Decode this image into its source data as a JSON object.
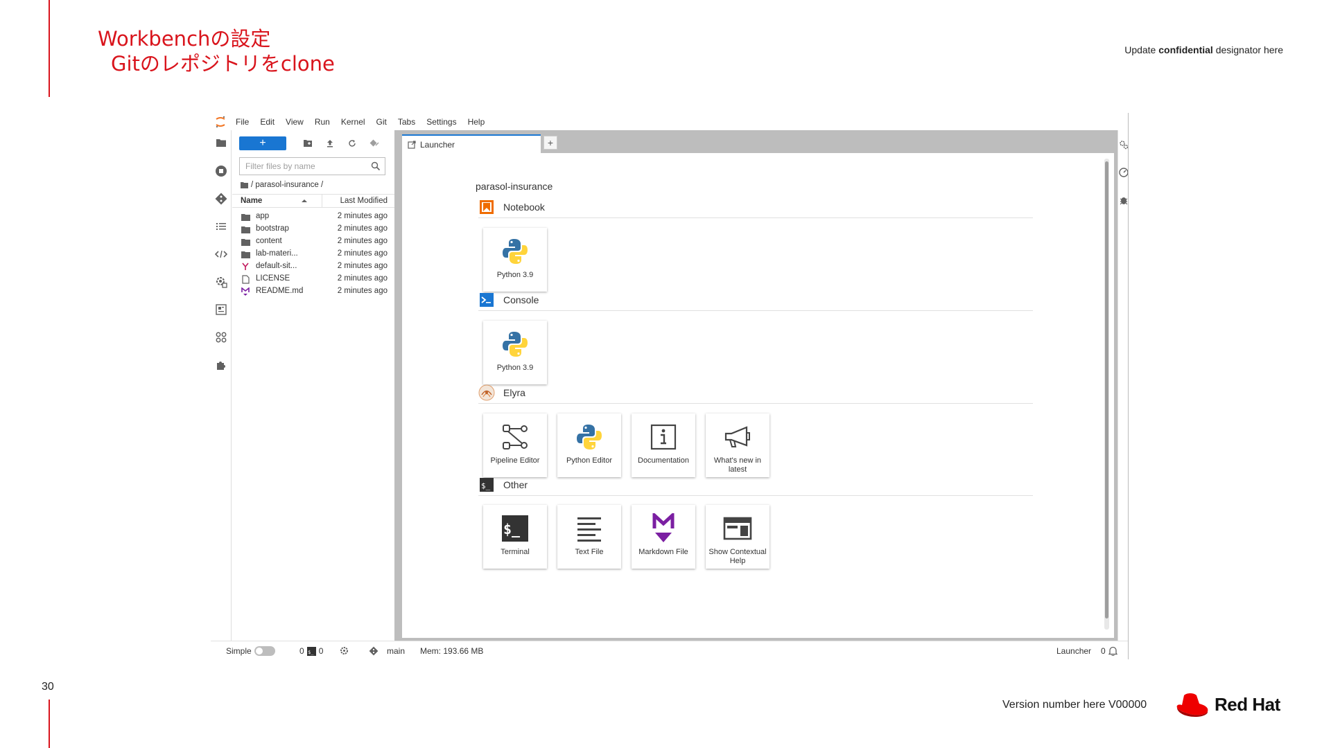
{
  "slide": {
    "title_line1": "Workbenchの設定",
    "title_line2": "Gitのレポジトリをclone",
    "confidential_prefix": "Update ",
    "confidential_bold": "confidential",
    "confidential_suffix": " designator here",
    "page_number": "30",
    "version": "Version number here V00000",
    "brand": "Red Hat",
    "accent": "#d9141c"
  },
  "menubar": {
    "items": [
      "File",
      "Edit",
      "View",
      "Run",
      "Kernel",
      "Git",
      "Tabs",
      "Settings",
      "Help"
    ]
  },
  "filebrowser": {
    "new_label": "+",
    "filter_placeholder": "Filter files by name",
    "breadcrumb": "/ parasol-insurance /",
    "col_name": "Name",
    "col_modified": "Last Modified",
    "files": [
      {
        "name": "app",
        "type": "folder",
        "modified": "2 minutes ago"
      },
      {
        "name": "bootstrap",
        "type": "folder",
        "modified": "2 minutes ago"
      },
      {
        "name": "content",
        "type": "folder",
        "modified": "2 minutes ago"
      },
      {
        "name": "lab-materi...",
        "type": "folder",
        "modified": "2 minutes ago"
      },
      {
        "name": "default-sit...",
        "type": "yaml",
        "modified": "2 minutes ago"
      },
      {
        "name": "LICENSE",
        "type": "file",
        "modified": "2 minutes ago"
      },
      {
        "name": "README.md",
        "type": "markdown",
        "modified": "2 minutes ago"
      }
    ]
  },
  "tab": {
    "label": "Launcher",
    "add_label": "+"
  },
  "launcher": {
    "cwd": "parasol-insurance",
    "sections": {
      "notebook": {
        "title": "Notebook",
        "cards": [
          {
            "label": "Python 3.9"
          }
        ]
      },
      "console": {
        "title": "Console",
        "cards": [
          {
            "label": "Python 3.9"
          }
        ]
      },
      "elyra": {
        "title": "Elyra",
        "cards": [
          {
            "label": "Pipeline Editor"
          },
          {
            "label": "Python Editor"
          },
          {
            "label": "Documentation"
          },
          {
            "label": "What's new in latest"
          }
        ]
      },
      "other": {
        "title": "Other",
        "cards": [
          {
            "label": "Terminal"
          },
          {
            "label": "Text File"
          },
          {
            "label": "Markdown File"
          },
          {
            "label": "Show Contextual Help"
          }
        ]
      }
    }
  },
  "statusbar": {
    "simple_label": "Simple",
    "kernels_count": "0",
    "terminals_count": "0",
    "branch": "main",
    "memory": "Mem: 193.66 MB",
    "mode": "Launcher",
    "notifications": "0"
  }
}
